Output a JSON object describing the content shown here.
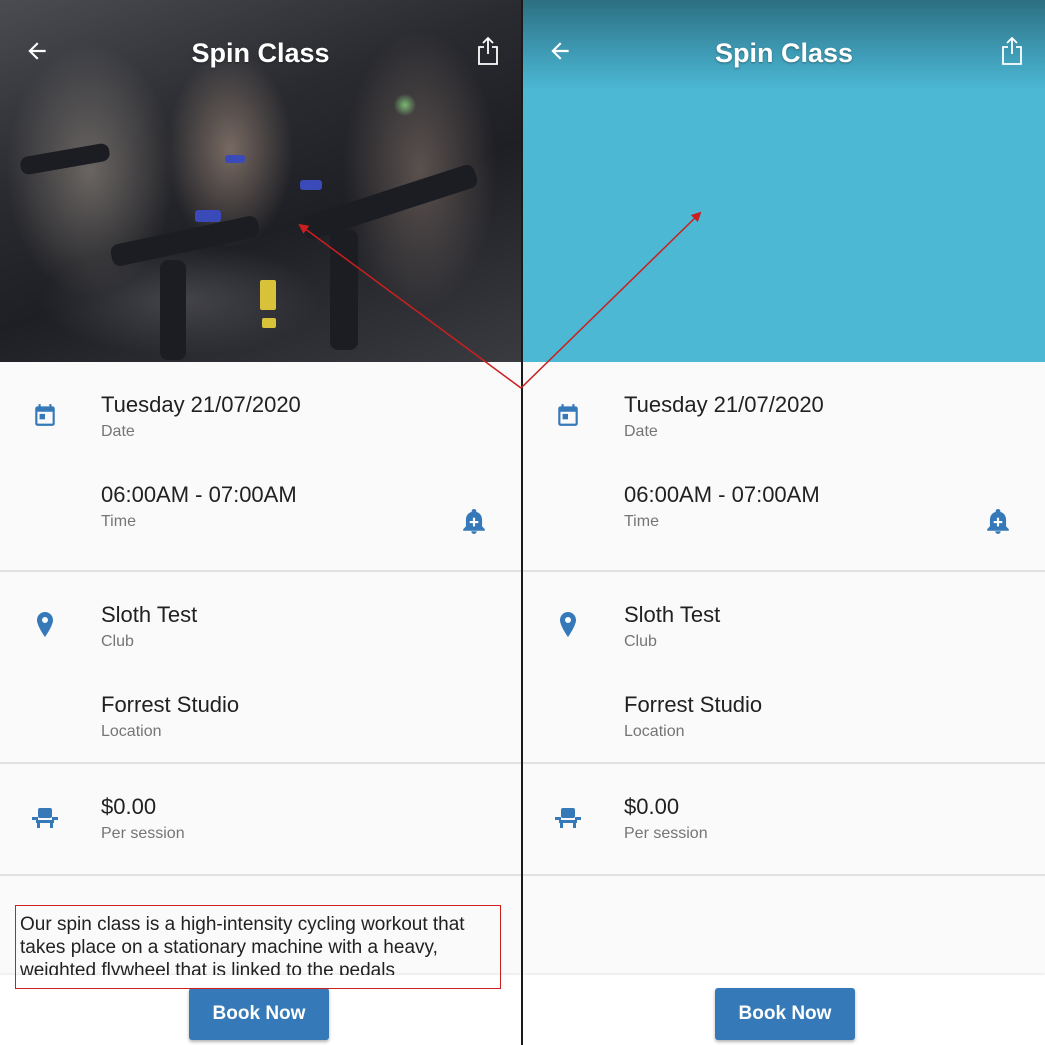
{
  "screens": {
    "left": {
      "title": "Spin Class",
      "date": {
        "value": "Tuesday  21/07/2020",
        "label": "Date"
      },
      "time": {
        "value": "06:00AM - 07:00AM",
        "label": "Time"
      },
      "club": {
        "value": "Sloth Test",
        "label": "Club"
      },
      "location": {
        "value": "Forrest Studio",
        "label": "Location"
      },
      "price": {
        "value": "$0.00",
        "label": "Per session"
      },
      "description": "Our spin class is a high-intensity cycling workout that takes place on a stationary machine with a heavy, weighted flywheel that is linked to the pedals",
      "book_label": "Book Now"
    },
    "right": {
      "title": "Spin Class",
      "date": {
        "value": "Tuesday  21/07/2020",
        "label": "Date"
      },
      "time": {
        "value": "06:00AM - 07:00AM",
        "label": "Time"
      },
      "club": {
        "value": "Sloth Test",
        "label": "Club"
      },
      "location": {
        "value": "Forrest Studio",
        "label": "Location"
      },
      "price": {
        "value": "$0.00",
        "label": "Per session"
      },
      "book_label": "Book Now"
    }
  },
  "icons": {
    "back": "arrow-left-icon",
    "share": "share-icon",
    "date": "calendar-icon",
    "time_action": "bell-plus-icon",
    "club": "map-pin-icon",
    "price": "seat-icon"
  },
  "colors": {
    "accent": "#3579b8",
    "hero_plain": "#4cb8d4",
    "annotation": "#cc1f1f"
  }
}
